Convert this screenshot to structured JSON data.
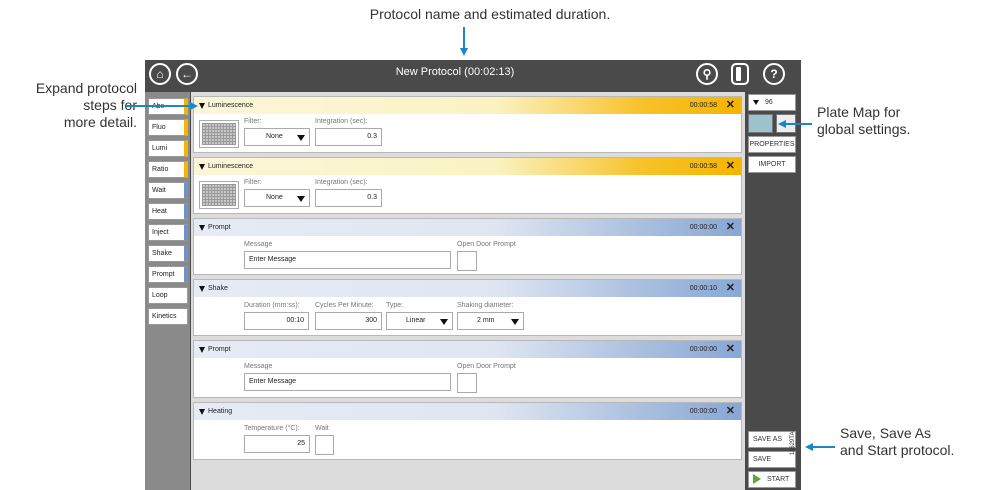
{
  "callouts": {
    "top": "Protocol name and estimated duration.",
    "left": [
      "Expand protocol",
      "steps for",
      "more detail."
    ],
    "plate_map": [
      "Plate Map for",
      "global settings."
    ],
    "save": [
      "Save, Save As",
      "and Start protocol."
    ],
    "figure_id": "11629TA"
  },
  "header": {
    "title": "New Protocol (00:02:13)",
    "home_icon": "home-icon",
    "back_icon": "back-arrow-icon",
    "signal_icon": "satellite-icon",
    "door_icon": "door-icon",
    "help_icon": "help-icon",
    "help_glyph": "?"
  },
  "toolbox": {
    "items": [
      {
        "label": "Abs",
        "accent": "#f5b400"
      },
      {
        "label": "Fluo",
        "accent": "#f5b400"
      },
      {
        "label": "Lumi",
        "accent": "#f5b400"
      },
      {
        "label": "Ratio",
        "accent": "#f5b400"
      },
      {
        "label": "Wait",
        "accent": "#6f92c8"
      },
      {
        "label": "Heat",
        "accent": "#6f92c8"
      },
      {
        "label": "Inject",
        "accent": "#6f92c8"
      },
      {
        "label": "Shake",
        "accent": "#6f92c8"
      },
      {
        "label": "Prompt",
        "accent": "#6f92c8"
      },
      {
        "label": "Loop",
        "accent": ""
      },
      {
        "label": "Kinetics",
        "accent": ""
      }
    ]
  },
  "steps": [
    {
      "title": "Luminescence",
      "duration": "00:00:58",
      "filter_label": "Filter:",
      "filter_value": "None",
      "integration_label": "Integration (sec):",
      "integration_value": "0.3"
    },
    {
      "title": "Luminescence",
      "duration": "00:00:58",
      "filter_label": "Filter:",
      "filter_value": "None",
      "integration_label": "Integration (sec):",
      "integration_value": "0.3"
    },
    {
      "title": "Prompt",
      "duration": "00:00:00",
      "message_label": "Message",
      "message_value": "Enter Message",
      "door_label": "Open Door Prompt"
    },
    {
      "title": "Shake",
      "duration": "00:00:10",
      "duration_label": "Duration (mm:ss):",
      "duration_value": "00:10",
      "cpm_label": "Cycles Per Minute:",
      "cpm_value": "300",
      "type_label": "Type:",
      "type_value": "Linear",
      "diameter_label": "Shaking diameter:",
      "diameter_value": "2 mm"
    },
    {
      "title": "Prompt",
      "duration": "00:00:00",
      "message_label": "Message",
      "message_value": "Enter Message",
      "door_label": "Open Door Prompt"
    },
    {
      "title": "Heating",
      "duration": "00:00:00",
      "temp_label": "Temperature (°C):",
      "temp_value": "25",
      "wait_label": "Wait"
    }
  ],
  "close_glyph": "✕",
  "right_panel": {
    "plate_label": "96",
    "properties_label": "PROPERTIES",
    "import_label": "IMPORT",
    "save_as_label": "SAVE AS",
    "save_label": "SAVE",
    "start_label": "START",
    "swatch_color": "#9cc3ce"
  },
  "colors": {
    "read_step": "#f5b400",
    "other_step": "#88a7d6",
    "callout_arrow": "#1b87c4",
    "start_icon": "#5fa832"
  }
}
